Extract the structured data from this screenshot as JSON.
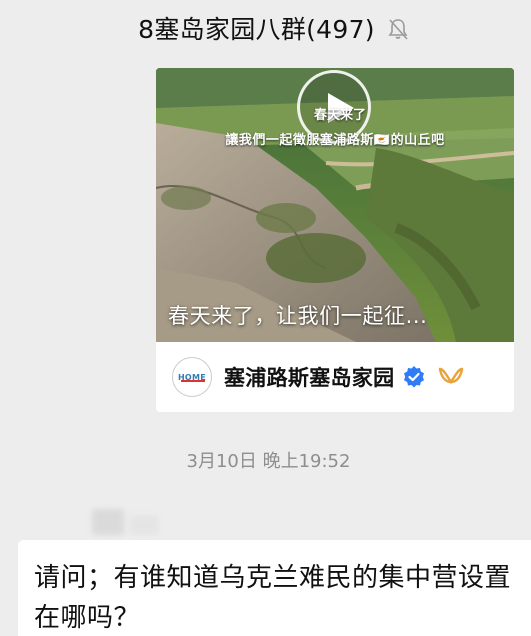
{
  "header": {
    "chat_title": "8塞岛家园八群(497)",
    "mute_icon": "bell-muted-icon"
  },
  "video_card": {
    "overlay_line1": "春天来了",
    "overlay_line2": "讓我們一起徵服塞浦路斯🇨🇾的山丘吧",
    "caption": "春天来了，让我们一起征...",
    "play_icon": "play-icon",
    "account_avatar_text": "HOME",
    "account_name": "塞浦路斯塞岛家园",
    "verified_icon": "verified-badge-icon",
    "channels_icon": "wechat-channels-icon",
    "colors": {
      "verified_blue": "#2f7cf6",
      "channels_gold": "#e8a33a"
    }
  },
  "timestamp": "3月10日 晚上19:52",
  "message": {
    "text": "请问；有谁知道乌克兰难民的集中营设置在哪吗？"
  }
}
